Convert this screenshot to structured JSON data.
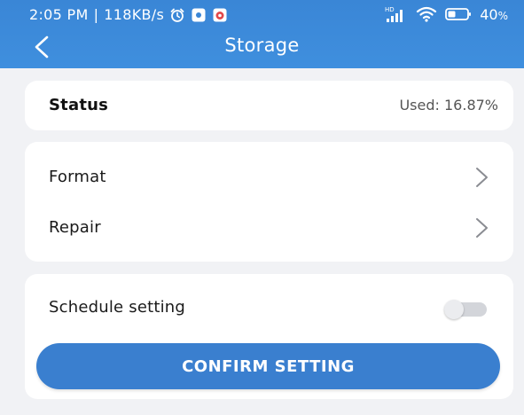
{
  "status_bar": {
    "time": "2:05 PM",
    "network_speed": "118KB/s",
    "battery_percent": "40",
    "battery_suffix": "%",
    "network_badge": "HD",
    "icons": [
      "alarm-icon",
      "app-notification-icon",
      "app-notification-icon-2",
      "signal-icon",
      "wifi-icon",
      "battery-icon"
    ]
  },
  "header": {
    "title": "Storage",
    "back_icon": "chevron-left-icon"
  },
  "status_card": {
    "label": "Status",
    "value": "Used: 16.87%"
  },
  "actions": {
    "items": [
      {
        "label": "Format",
        "icon": "chevron-right-icon"
      },
      {
        "label": "Repair",
        "icon": "chevron-right-icon"
      }
    ]
  },
  "schedule": {
    "label": "Schedule setting",
    "enabled": false,
    "confirm_label": "CONFIRM SETTING"
  },
  "colors": {
    "header": "#3a86d6",
    "button": "#3a7fcf",
    "background": "#f1f2f5",
    "card": "#ffffff"
  }
}
